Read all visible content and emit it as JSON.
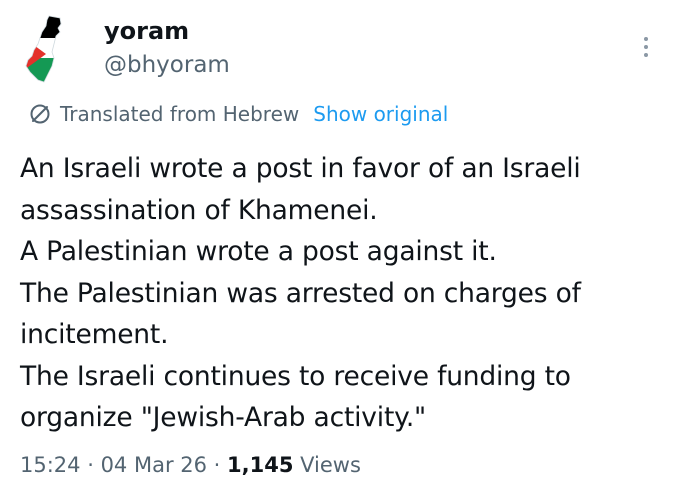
{
  "user": {
    "name": "yoram",
    "handle": "@bhyoram"
  },
  "translation": {
    "label": "Translated from Hebrew",
    "show_original": "Show original"
  },
  "tweet": {
    "lines": [
      "An Israeli wrote a post in favor of an Israeli",
      "assassination of Khamenei.",
      "A Palestinian wrote a post against it.",
      "The Palestinian was arrested on charges of",
      "incitement.",
      "The Israeli continues to receive funding to",
      "organize \"Jewish-Arab activity.\""
    ]
  },
  "meta": {
    "time": "15:24",
    "sep1": " · ",
    "date": "04 Mar 26",
    "sep2": " · ",
    "views_count": "1,145",
    "views_label": " Views"
  },
  "colors": {
    "text": "#0f1419",
    "secondary": "#536471",
    "link": "#1d9bf0",
    "flag_red": "#e4312b",
    "flag_green": "#149954",
    "flag_black": "#000000"
  },
  "icons": {
    "avatar": "palestine-map-flag-icon",
    "translate": "translate-icon",
    "more": "more-options-icon"
  }
}
